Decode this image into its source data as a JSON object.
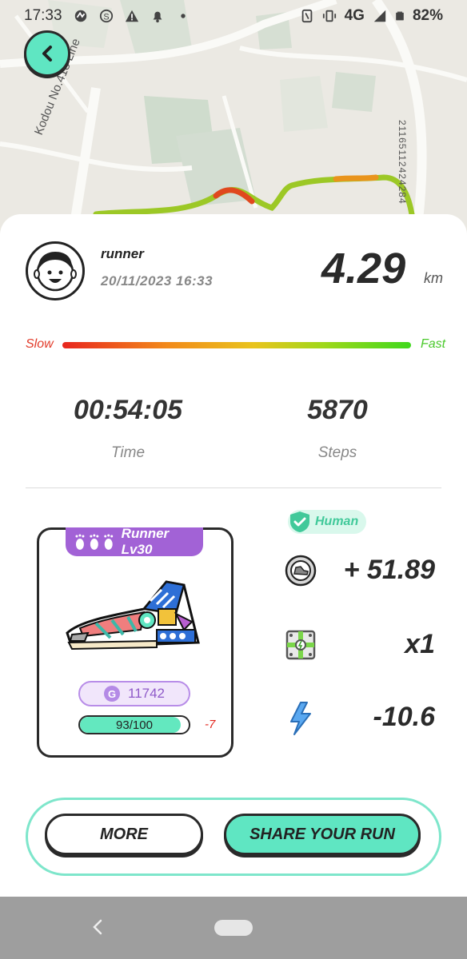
{
  "status_bar": {
    "time": "17:33",
    "network": "4G",
    "battery": "82%",
    "left_icons": [
      "signal-app-icon",
      "s-app-icon",
      "warning-icon",
      "notification-bell-icon",
      "dot-icon"
    ],
    "right_icons": [
      "nfc-icon",
      "vibrate-icon",
      "cellular-signal-icon",
      "battery-icon"
    ]
  },
  "map": {
    "road_label": "Kodou No.418 Line",
    "code_label": "21165112424284"
  },
  "user": {
    "name": "runner",
    "datetime": "20/11/2023 16:33"
  },
  "distance": {
    "value": "4.29",
    "unit": "km"
  },
  "speed_legend": {
    "slow": "Slow",
    "fast": "Fast"
  },
  "stats": {
    "time_value": "00:54:05",
    "time_label": "Time",
    "steps_value": "5870",
    "steps_label": "Steps"
  },
  "shoe": {
    "badge": "Runner Lv30",
    "gem_value": "11742",
    "durability_text": "93/100",
    "durability_fraction": 0.93,
    "durability_change": "-7"
  },
  "rewards": {
    "verification": "Human",
    "gst": "+ 51.89",
    "mystery_box": "x1",
    "energy": "-10.6"
  },
  "buttons": {
    "more": "MORE",
    "share": "SHARE YOUR RUN"
  },
  "colors": {
    "accent": "#5fe6c2",
    "badge_purple": "#a262d6",
    "slow": "#e23b2a",
    "fast": "#49c92a"
  }
}
